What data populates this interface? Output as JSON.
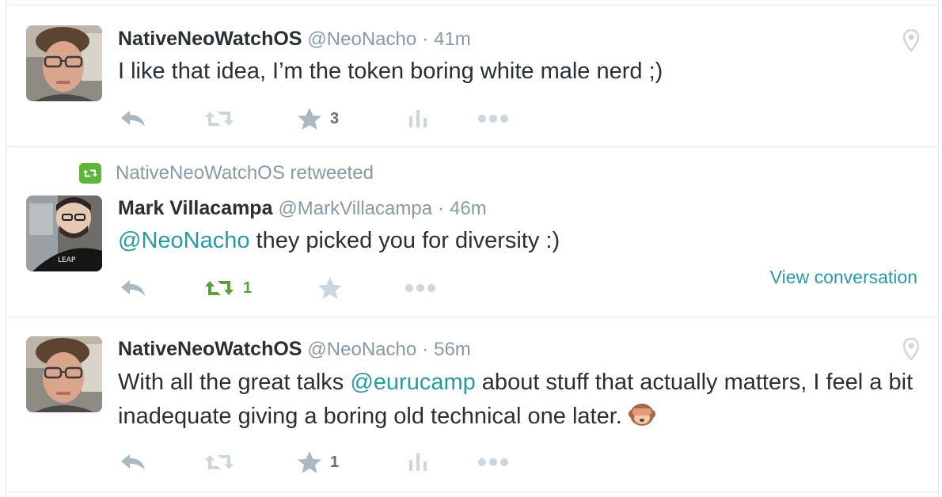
{
  "tweets": [
    {
      "fullname": "NativeNeoWatchOS",
      "handle": "@NeoNacho",
      "sep": "·",
      "time": "41m",
      "text": "I like that idea, I’m the token boring white male nerd ;)",
      "favorites": "3",
      "icons": [
        "reply-icon",
        "retweet-icon",
        "star-icon",
        "analytics-icon",
        "more-icon",
        "location-pin-icon"
      ]
    },
    {
      "context": "NativeNeoWatchOS retweeted",
      "fullname": "Mark Villacampa",
      "handle": "@MarkVillacampa",
      "sep": "·",
      "time": "46m",
      "mention": "@NeoNacho",
      "text_rest": " they picked you for diversity :)",
      "retweets": "1",
      "view_conversation": "View conversation",
      "retweet_color": "#5c9e3a"
    },
    {
      "fullname": "NativeNeoWatchOS",
      "handle": "@NeoNacho",
      "sep": "·",
      "time": "56m",
      "text_part1": "With all the great talks ",
      "mention": "@eurucamp",
      "text_part2": " about stuff that actually matters, I feel a bit inadequate giving a boring old technical one later. ",
      "emoji": "see-no-evil-monkey",
      "favorites": "1"
    }
  ],
  "colors": {
    "link": "#2b9a9f",
    "muted": "#8899a6",
    "icon": "#aab8c2",
    "retweet_active": "#5c9e3a",
    "border": "#e1e8ed"
  }
}
